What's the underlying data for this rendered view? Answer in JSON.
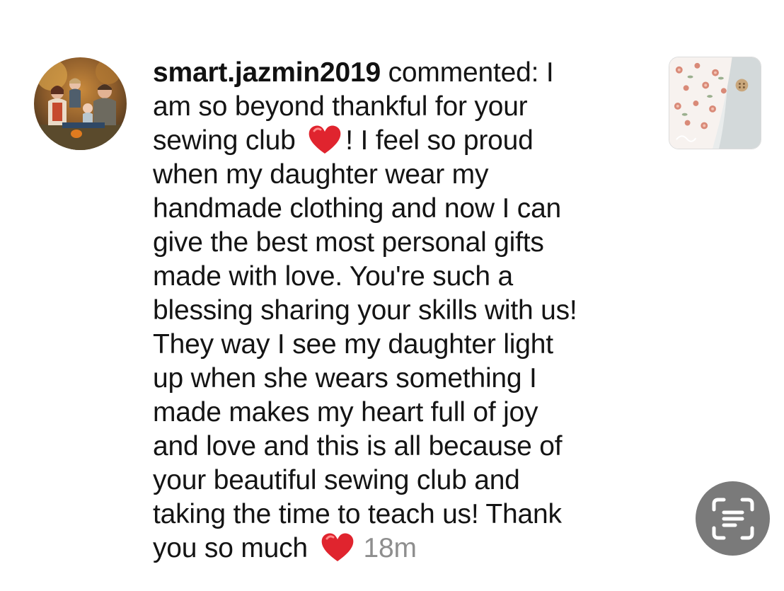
{
  "comment": {
    "username": "smart.jazmin2019",
    "lines": [
      " commented: I",
      "am so beyond thankful for your",
      "sewing club ",
      "! I feel so proud",
      "when my daughter wear my",
      "handmade clothing and now I can",
      "give the best most personal gifts",
      "made with love. You're such a",
      "blessing sharing your skills with us!",
      "They way I see my daughter light",
      "up when she wears something I",
      "made makes my heart full of joy",
      "and love and this is all because of",
      "your beautiful sewing club and",
      "taking the time to teach us! Thank",
      "you so much "
    ],
    "timestamp": "18m"
  },
  "icons": {
    "avatar": "user-avatar-family-photo",
    "heart": "red-heart-emoji",
    "post_thumbnail": "floral-fabric-post-thumbnail",
    "scan": "live-text-scan-icon"
  },
  "colors": {
    "heart": "#e0242e",
    "timestamp": "#8e8e8e",
    "scan_button_bg": "#7a7a7a",
    "text": "#141414"
  }
}
